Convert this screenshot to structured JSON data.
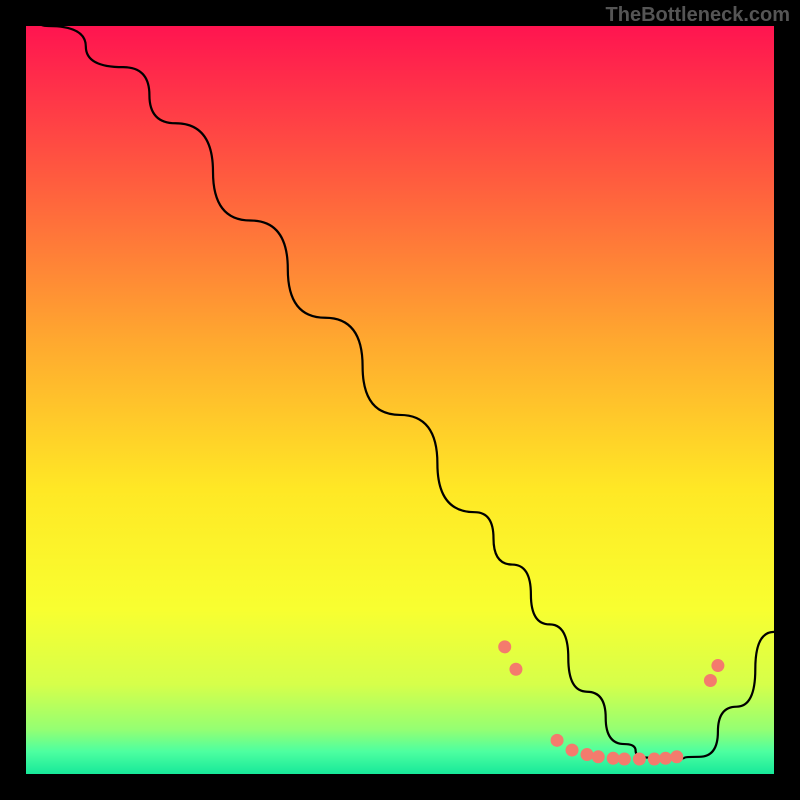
{
  "watermark": "TheBottleneck.com",
  "chart_data": {
    "type": "line",
    "title": "",
    "xlabel": "",
    "ylabel": "",
    "xlim": [
      0,
      100
    ],
    "ylim": [
      0,
      100
    ],
    "grid": false,
    "legend": false,
    "background_gradient_stops": [
      {
        "pos": 0.0,
        "color": "#ff1450"
      },
      {
        "pos": 0.2,
        "color": "#ff5a3f"
      },
      {
        "pos": 0.42,
        "color": "#ffa82f"
      },
      {
        "pos": 0.62,
        "color": "#ffe825"
      },
      {
        "pos": 0.78,
        "color": "#f8ff30"
      },
      {
        "pos": 0.88,
        "color": "#d6ff4a"
      },
      {
        "pos": 0.94,
        "color": "#95ff72"
      },
      {
        "pos": 0.97,
        "color": "#4dffa0"
      },
      {
        "pos": 1.0,
        "color": "#17e99a"
      }
    ],
    "series": [
      {
        "name": "curve",
        "x": [
          0,
          3,
          13,
          20,
          30,
          40,
          50,
          60,
          65,
          70,
          75,
          80,
          83,
          86,
          90,
          95,
          100
        ],
        "y": [
          102,
          100,
          94.5,
          87,
          74,
          61,
          48,
          35,
          28,
          20,
          11,
          4,
          2.2,
          2.0,
          2.3,
          9,
          19
        ]
      }
    ],
    "dots": [
      {
        "x": 64.0,
        "y": 17.0
      },
      {
        "x": 65.5,
        "y": 14.0
      },
      {
        "x": 71.0,
        "y": 4.5
      },
      {
        "x": 73.0,
        "y": 3.2
      },
      {
        "x": 75.0,
        "y": 2.6
      },
      {
        "x": 76.5,
        "y": 2.3
      },
      {
        "x": 78.5,
        "y": 2.1
      },
      {
        "x": 80.0,
        "y": 2.0
      },
      {
        "x": 82.0,
        "y": 2.0
      },
      {
        "x": 84.0,
        "y": 2.0
      },
      {
        "x": 85.5,
        "y": 2.1
      },
      {
        "x": 87.0,
        "y": 2.3
      },
      {
        "x": 91.5,
        "y": 12.5
      },
      {
        "x": 92.5,
        "y": 14.5
      }
    ]
  }
}
